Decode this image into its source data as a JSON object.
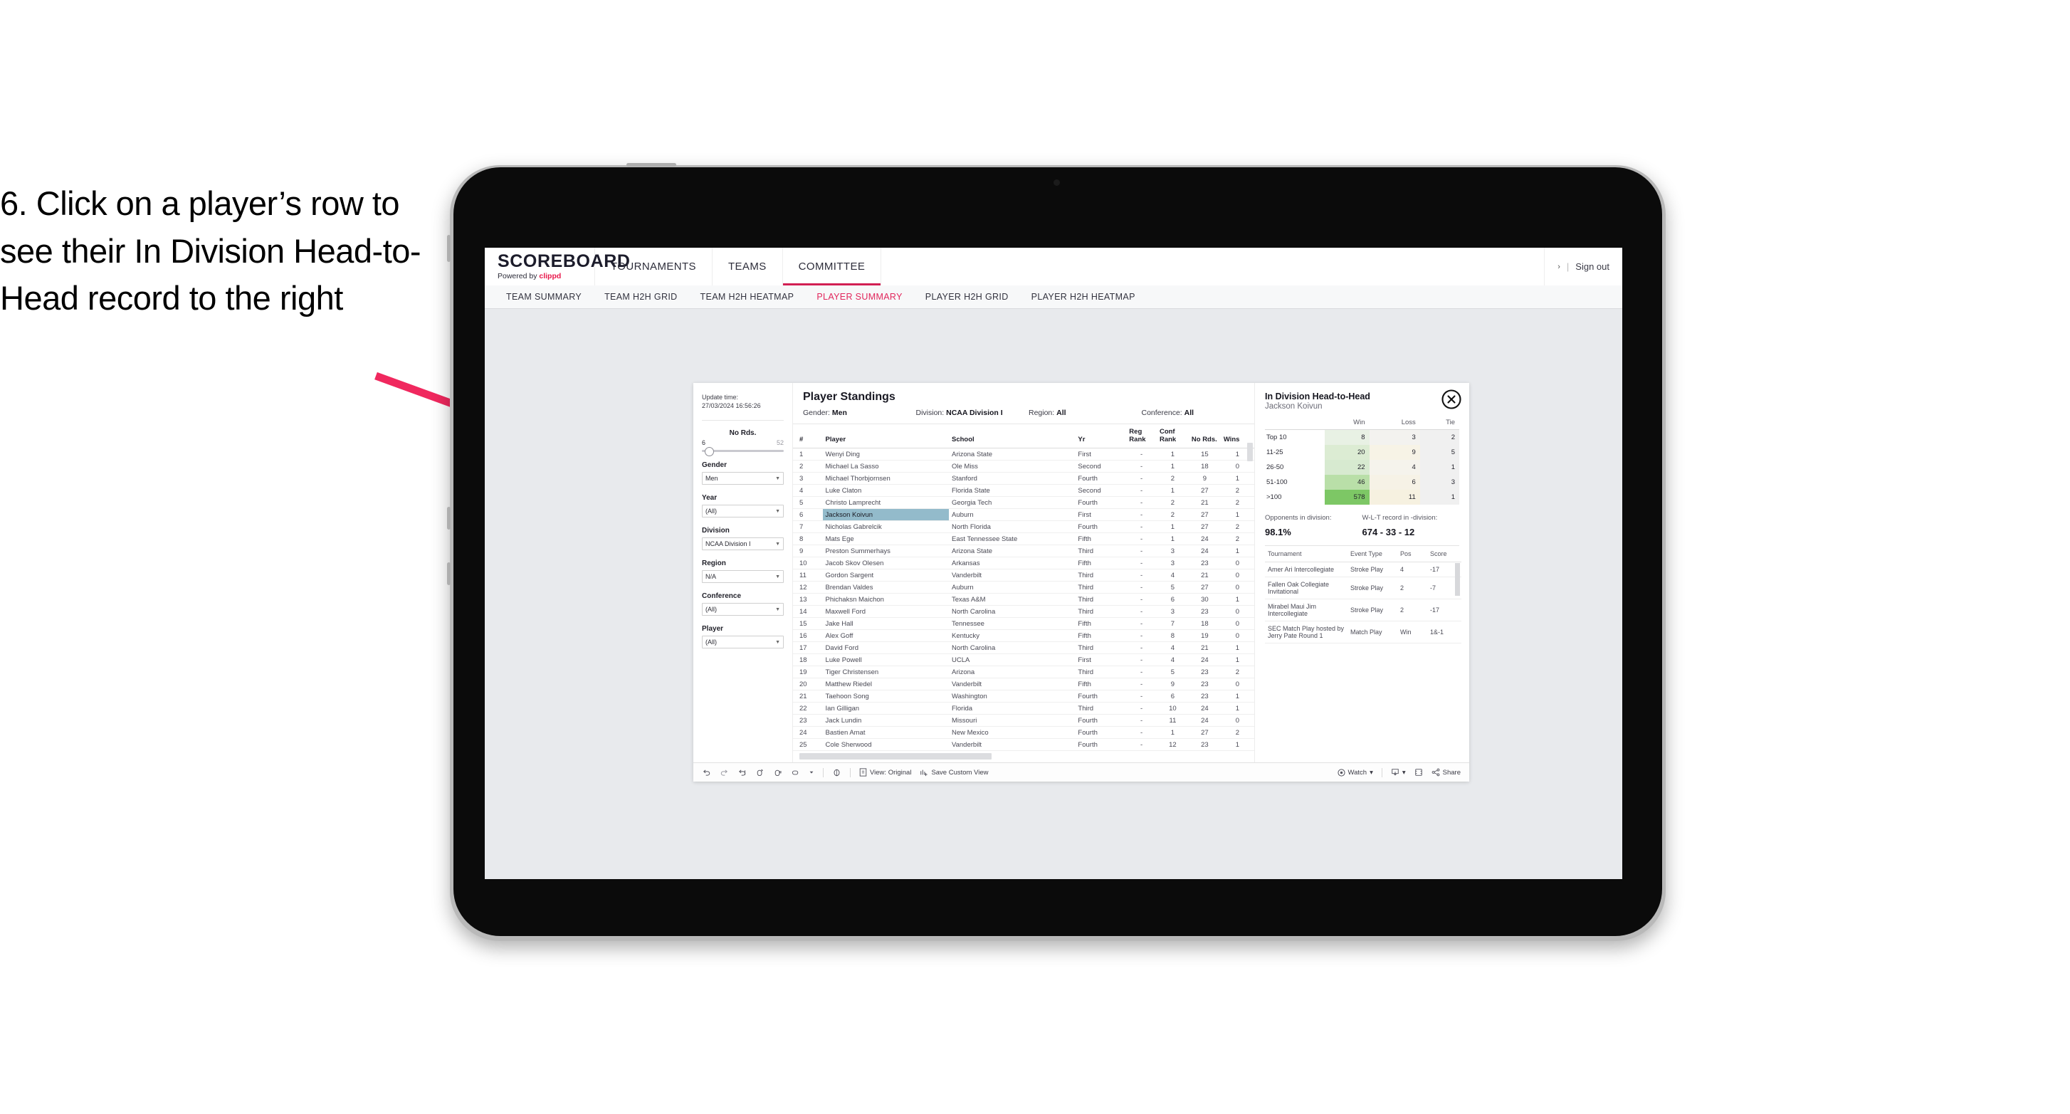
{
  "instruction": "6. Click on a player’s row to see their In Division Head-to-Head record to the right",
  "accent": "#e1265c",
  "header": {
    "logo_main": "SCOREBOARD",
    "logo_sub_prefix": "Powered by",
    "logo_sub_brand": "clippd",
    "tabs": [
      {
        "label": "TOURNAMENTS",
        "active": false
      },
      {
        "label": "TEAMS",
        "active": false
      },
      {
        "label": "COMMITTEE",
        "active": true
      }
    ],
    "chevron": "›",
    "divider": "|",
    "sign_out": "Sign out"
  },
  "subnav": {
    "tabs": [
      {
        "label": "TEAM SUMMARY",
        "active": false
      },
      {
        "label": "TEAM H2H GRID",
        "active": false
      },
      {
        "label": "TEAM H2H HEATMAP",
        "active": false
      },
      {
        "label": "PLAYER SUMMARY",
        "active": true
      },
      {
        "label": "PLAYER H2H GRID",
        "active": false
      },
      {
        "label": "PLAYER H2H HEATMAP",
        "active": false
      }
    ]
  },
  "filters": {
    "update_time_label": "Update time:",
    "update_time_value": "27/03/2024 16:56:26",
    "slider": {
      "title": "No Rds.",
      "min": "6",
      "max": "52"
    },
    "groups": [
      {
        "title": "Gender",
        "value": "Men"
      },
      {
        "title": "Year",
        "value": "(All)"
      },
      {
        "title": "Division",
        "value": "NCAA Division I"
      },
      {
        "title": "Region",
        "value": "N/A"
      },
      {
        "title": "Conference",
        "value": "(All)"
      },
      {
        "title": "Player",
        "value": "(All)"
      }
    ]
  },
  "standings": {
    "title": "Player Standings",
    "summary": [
      {
        "label": "Gender:",
        "value": "Men"
      },
      {
        "label": "Division:",
        "value": "NCAA Division I"
      },
      {
        "label": "Region:",
        "value": "All"
      },
      {
        "label": "Conference:",
        "value": "All"
      }
    ],
    "columns": [
      "#",
      "Player",
      "School",
      "Yr",
      "Reg Rank",
      "Conf Rank",
      "No Rds.",
      "Wins"
    ],
    "rows": [
      {
        "n": "1",
        "player": "Wenyi Ding",
        "school": "Arizona State",
        "yr": "First",
        "reg": "-",
        "conf": "1",
        "rds": "15",
        "wins": "1",
        "selected": false
      },
      {
        "n": "2",
        "player": "Michael La Sasso",
        "school": "Ole Miss",
        "yr": "Second",
        "reg": "-",
        "conf": "1",
        "rds": "18",
        "wins": "0",
        "selected": false
      },
      {
        "n": "3",
        "player": "Michael Thorbjornsen",
        "school": "Stanford",
        "yr": "Fourth",
        "reg": "-",
        "conf": "2",
        "rds": "9",
        "wins": "1",
        "selected": false
      },
      {
        "n": "4",
        "player": "Luke Claton",
        "school": "Florida State",
        "yr": "Second",
        "reg": "-",
        "conf": "1",
        "rds": "27",
        "wins": "2",
        "selected": false
      },
      {
        "n": "5",
        "player": "Christo Lamprecht",
        "school": "Georgia Tech",
        "yr": "Fourth",
        "reg": "-",
        "conf": "2",
        "rds": "21",
        "wins": "2",
        "selected": false
      },
      {
        "n": "6",
        "player": "Jackson Koivun",
        "school": "Auburn",
        "yr": "First",
        "reg": "-",
        "conf": "2",
        "rds": "27",
        "wins": "1",
        "selected": true
      },
      {
        "n": "7",
        "player": "Nicholas Gabrelcik",
        "school": "North Florida",
        "yr": "Fourth",
        "reg": "-",
        "conf": "1",
        "rds": "27",
        "wins": "2",
        "selected": false
      },
      {
        "n": "8",
        "player": "Mats Ege",
        "school": "East Tennessee State",
        "yr": "Fifth",
        "reg": "-",
        "conf": "1",
        "rds": "24",
        "wins": "2",
        "selected": false
      },
      {
        "n": "9",
        "player": "Preston Summerhays",
        "school": "Arizona State",
        "yr": "Third",
        "reg": "-",
        "conf": "3",
        "rds": "24",
        "wins": "1",
        "selected": false
      },
      {
        "n": "10",
        "player": "Jacob Skov Olesen",
        "school": "Arkansas",
        "yr": "Fifth",
        "reg": "-",
        "conf": "3",
        "rds": "23",
        "wins": "0",
        "selected": false
      },
      {
        "n": "11",
        "player": "Gordon Sargent",
        "school": "Vanderbilt",
        "yr": "Third",
        "reg": "-",
        "conf": "4",
        "rds": "21",
        "wins": "0",
        "selected": false
      },
      {
        "n": "12",
        "player": "Brendan Valdes",
        "school": "Auburn",
        "yr": "Third",
        "reg": "-",
        "conf": "5",
        "rds": "27",
        "wins": "0",
        "selected": false
      },
      {
        "n": "13",
        "player": "Phichaksn Maichon",
        "school": "Texas A&M",
        "yr": "Third",
        "reg": "-",
        "conf": "6",
        "rds": "30",
        "wins": "1",
        "selected": false
      },
      {
        "n": "14",
        "player": "Maxwell Ford",
        "school": "North Carolina",
        "yr": "Third",
        "reg": "-",
        "conf": "3",
        "rds": "23",
        "wins": "0",
        "selected": false
      },
      {
        "n": "15",
        "player": "Jake Hall",
        "school": "Tennessee",
        "yr": "Fifth",
        "reg": "-",
        "conf": "7",
        "rds": "18",
        "wins": "0",
        "selected": false
      },
      {
        "n": "16",
        "player": "Alex Goff",
        "school": "Kentucky",
        "yr": "Fifth",
        "reg": "-",
        "conf": "8",
        "rds": "19",
        "wins": "0",
        "selected": false
      },
      {
        "n": "17",
        "player": "David Ford",
        "school": "North Carolina",
        "yr": "Third",
        "reg": "-",
        "conf": "4",
        "rds": "21",
        "wins": "1",
        "selected": false
      },
      {
        "n": "18",
        "player": "Luke Powell",
        "school": "UCLA",
        "yr": "First",
        "reg": "-",
        "conf": "4",
        "rds": "24",
        "wins": "1",
        "selected": false
      },
      {
        "n": "19",
        "player": "Tiger Christensen",
        "school": "Arizona",
        "yr": "Third",
        "reg": "-",
        "conf": "5",
        "rds": "23",
        "wins": "2",
        "selected": false
      },
      {
        "n": "20",
        "player": "Matthew Riedel",
        "school": "Vanderbilt",
        "yr": "Fifth",
        "reg": "-",
        "conf": "9",
        "rds": "23",
        "wins": "0",
        "selected": false
      },
      {
        "n": "21",
        "player": "Taehoon Song",
        "school": "Washington",
        "yr": "Fourth",
        "reg": "-",
        "conf": "6",
        "rds": "23",
        "wins": "1",
        "selected": false
      },
      {
        "n": "22",
        "player": "Ian Gilligan",
        "school": "Florida",
        "yr": "Third",
        "reg": "-",
        "conf": "10",
        "rds": "24",
        "wins": "1",
        "selected": false
      },
      {
        "n": "23",
        "player": "Jack Lundin",
        "school": "Missouri",
        "yr": "Fourth",
        "reg": "-",
        "conf": "11",
        "rds": "24",
        "wins": "0",
        "selected": false
      },
      {
        "n": "24",
        "player": "Bastien Amat",
        "school": "New Mexico",
        "yr": "Fourth",
        "reg": "-",
        "conf": "1",
        "rds": "27",
        "wins": "2",
        "selected": false
      },
      {
        "n": "25",
        "player": "Cole Sherwood",
        "school": "Vanderbilt",
        "yr": "Fourth",
        "reg": "-",
        "conf": "12",
        "rds": "23",
        "wins": "1",
        "selected": false
      }
    ]
  },
  "h2h": {
    "title": "In Division Head-to-Head",
    "player": "Jackson Koivun",
    "close_icon": "close-circle-icon",
    "columns": [
      "",
      "Win",
      "Loss",
      "Tie"
    ],
    "rows": [
      {
        "bucket": "Top 10",
        "win": "8",
        "loss": "3",
        "tie": "2",
        "win_bg": "#e8f1e4",
        "loss_bg": "#f3f2ef",
        "tie_bg": "#f0f0f0"
      },
      {
        "bucket": "11-25",
        "win": "20",
        "loss": "9",
        "tie": "5",
        "win_bg": "#dcecd3",
        "loss_bg": "#f7f3e6",
        "tie_bg": "#f0f0f0"
      },
      {
        "bucket": "26-50",
        "win": "22",
        "loss": "4",
        "tie": "1",
        "win_bg": "#d7ead0",
        "loss_bg": "#f5f3ec",
        "tie_bg": "#f0f0f0"
      },
      {
        "bucket": "51-100",
        "win": "46",
        "loss": "6",
        "tie": "3",
        "win_bg": "#b9dfa8",
        "loss_bg": "#f6f2e6",
        "tie_bg": "#f0f0f0"
      },
      {
        "bucket": ">100",
        "win": "578",
        "loss": "11",
        "tie": "1",
        "win_bg": "#7dc765",
        "loss_bg": "#f6f1e0",
        "tie_bg": "#f0f0f0"
      }
    ],
    "stats": [
      {
        "label": "Opponents in division:",
        "value": "98.1%"
      },
      {
        "label": "W-L-T record in -division:",
        "value": "674 - 33 - 12"
      }
    ],
    "tournament_columns": [
      "Tournament",
      "Event Type",
      "Pos",
      "Score"
    ],
    "tournaments": [
      {
        "name": "Amer Ari Intercollegiate",
        "type": "Stroke Play",
        "pos": "4",
        "score": "-17"
      },
      {
        "name": "Fallen Oak Collegiate Invitational",
        "type": "Stroke Play",
        "pos": "2",
        "score": "-7"
      },
      {
        "name": "Mirabel Maui Jim Intercollegiate",
        "type": "Stroke Play",
        "pos": "2",
        "score": "-17"
      },
      {
        "name": "SEC Match Play hosted by Jerry Pate Round 1",
        "type": "Match Play",
        "pos": "Win",
        "score": "1&-1"
      }
    ]
  },
  "toolbar": {
    "icons": [
      "undo-icon",
      "redo-icon",
      "revert-icon",
      "refresh-icon",
      "pause-icon",
      "zoom-icon",
      "chevron-down-icon",
      "presentation-icon"
    ],
    "view_label": "View: Original",
    "save_label": "Save Custom View",
    "watch_label": "Watch",
    "watch_caret": "▾",
    "download_caret": "▾",
    "share_label": "Share"
  }
}
